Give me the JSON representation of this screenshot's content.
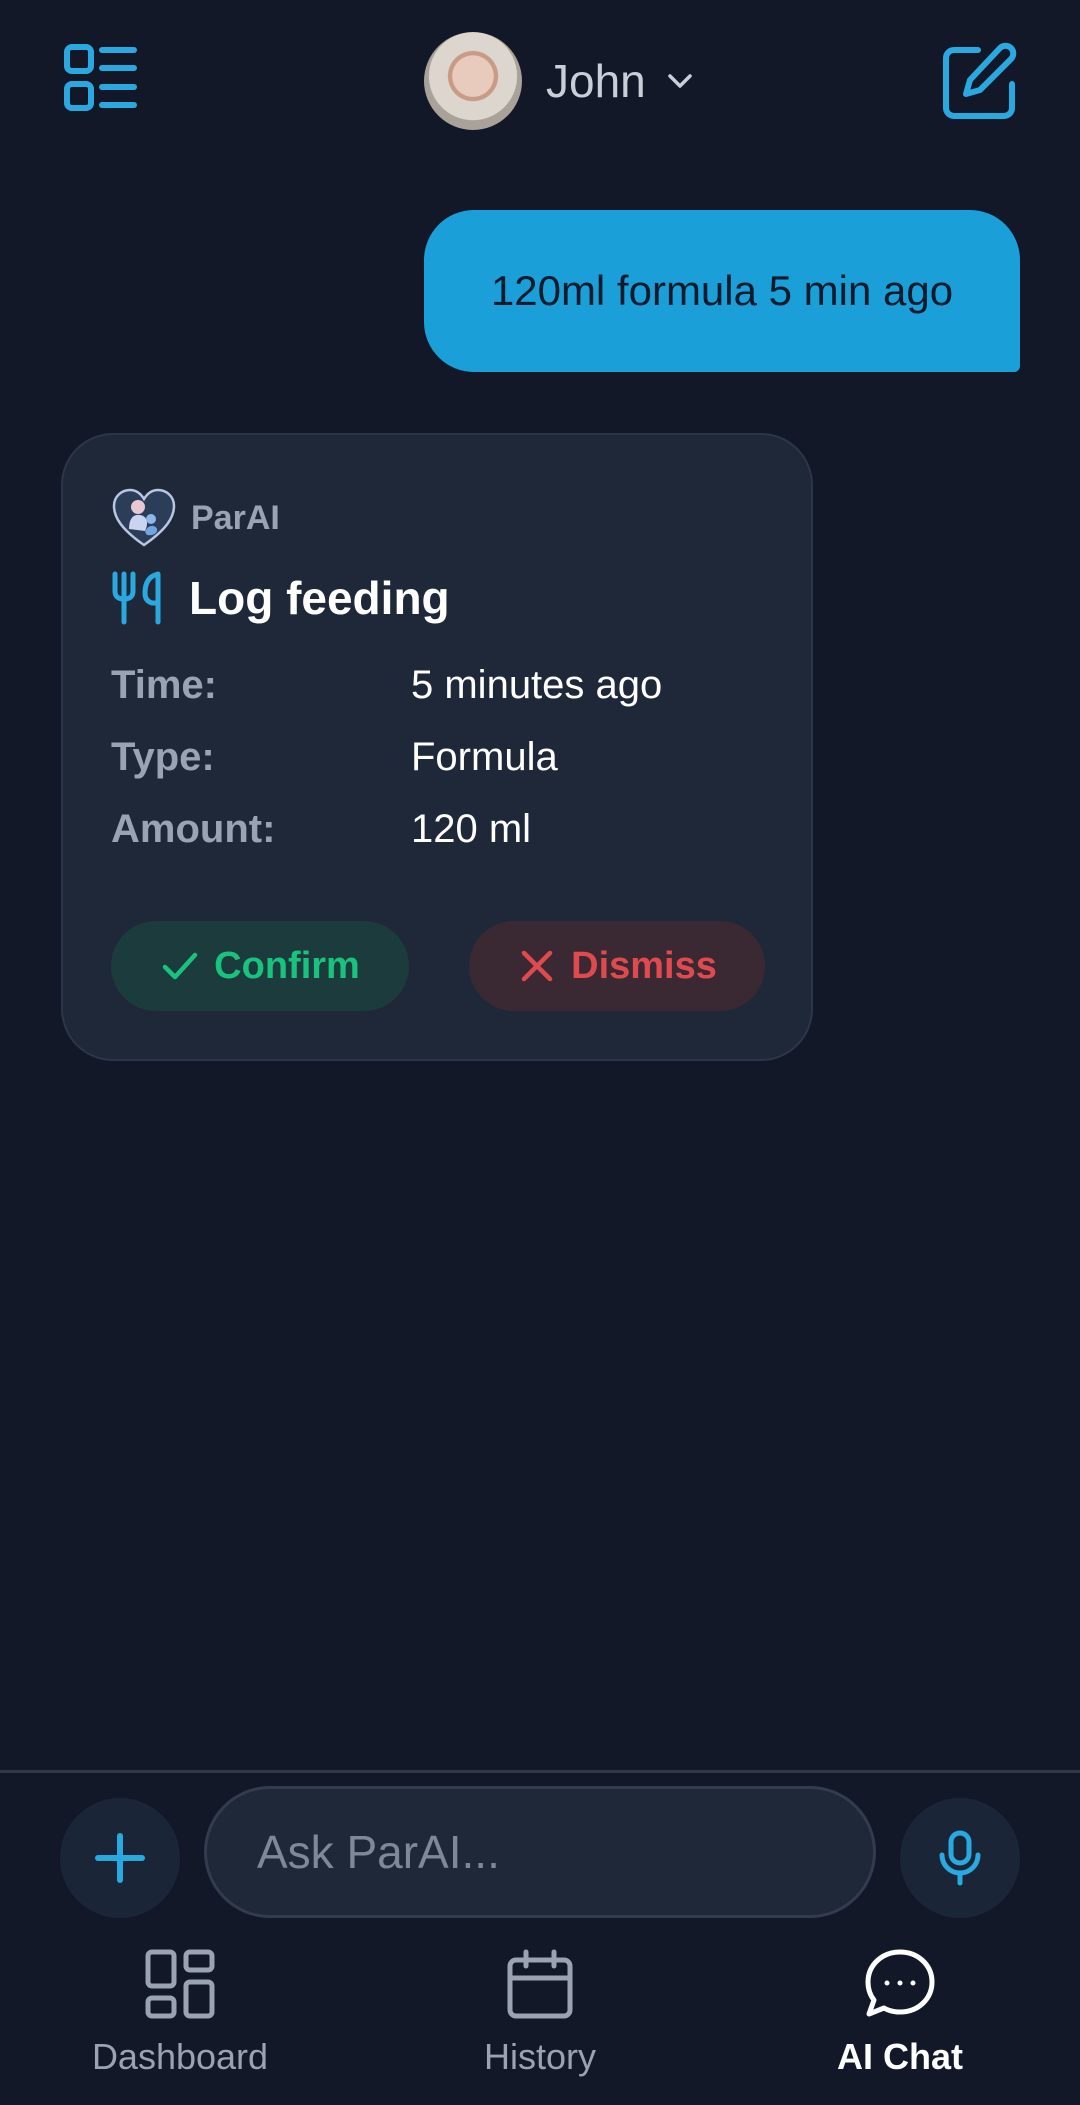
{
  "header": {
    "menu_icon": "list-layout-icon",
    "profile_name": "John",
    "profile_dropdown_icon": "chevron-down-icon",
    "edit_icon": "edit-icon"
  },
  "messages": [
    {
      "sender": "user",
      "text": "120ml formula 5 min ago"
    }
  ],
  "ai_card": {
    "assistant_name": "ParAI",
    "logo_icon": "parent-heart-logo-icon",
    "action_icon": "fork-knife-icon",
    "title": "Log feeding",
    "fields": [
      {
        "label": "Time:",
        "value": "5 minutes ago"
      },
      {
        "label": "Type:",
        "value": "Formula"
      },
      {
        "label": "Amount:",
        "value": "120 ml"
      }
    ],
    "confirm_label": "Confirm",
    "dismiss_label": "Dismiss"
  },
  "composer": {
    "placeholder": "Ask ParAI...",
    "add_icon": "plus-icon",
    "mic_icon": "microphone-icon"
  },
  "nav": {
    "items": [
      {
        "label": "Dashboard",
        "icon": "dashboard-icon",
        "active": false
      },
      {
        "label": "History",
        "icon": "calendar-icon",
        "active": false
      },
      {
        "label": "AI Chat",
        "icon": "chat-bubble-icon",
        "active": true
      }
    ]
  },
  "colors": {
    "background": "#121828",
    "accent": "#1a9fd8",
    "card": "#1f2839",
    "confirm": "#19c37d",
    "dismiss": "#e04a4f"
  }
}
